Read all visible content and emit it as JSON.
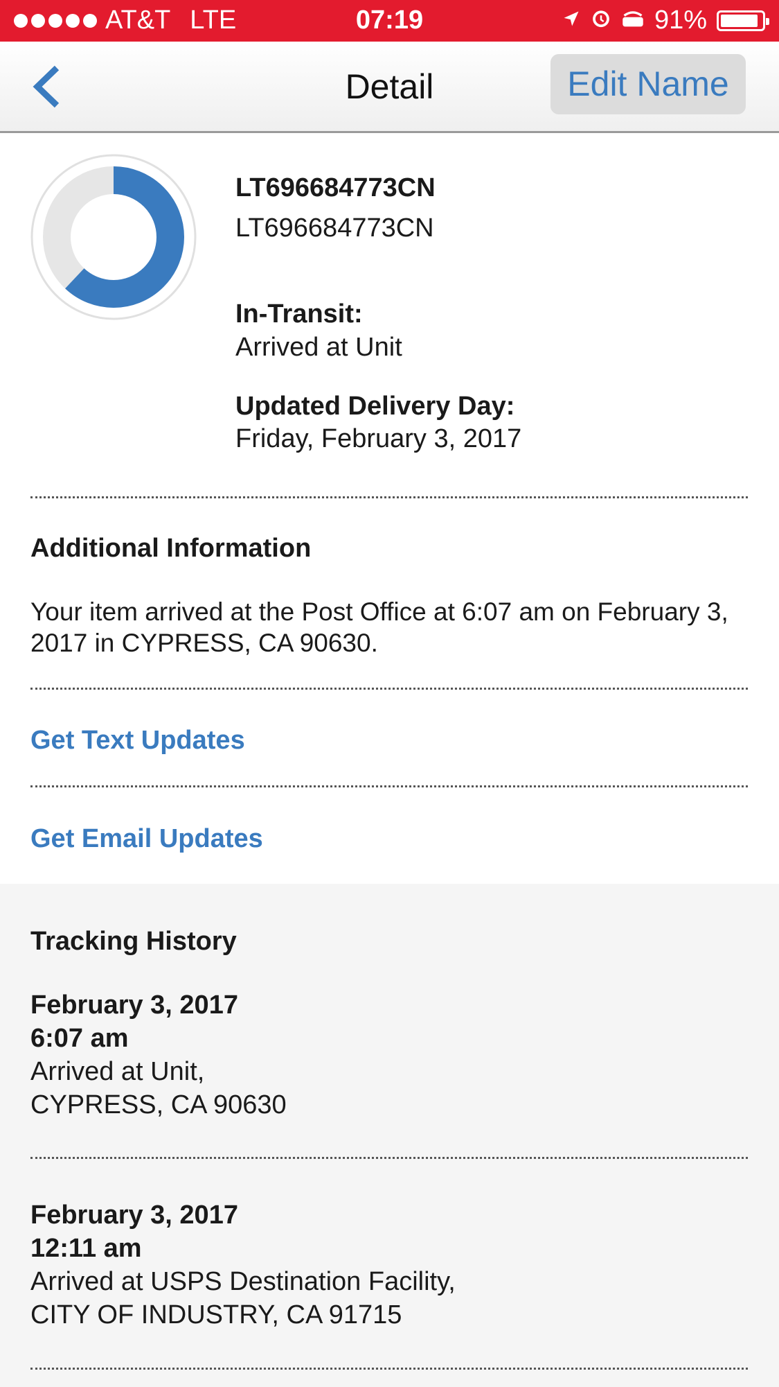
{
  "status_bar": {
    "carrier": "AT&T",
    "network": "LTE",
    "time": "07:19",
    "battery": "91%",
    "battery_level": 0.91
  },
  "nav": {
    "back_icon": "chevron-left-icon",
    "title": "Detail",
    "edit_label": "Edit Name"
  },
  "package": {
    "progress": 0.62,
    "tracking_bold": "LT696684773CN",
    "tracking": "LT696684773CN",
    "status_label": "In-Transit:",
    "status_value": "Arrived at Unit",
    "delivery_label": "Updated Delivery Day:",
    "delivery_value": "Friday, February 3, 2017"
  },
  "additional": {
    "title": "Additional Information",
    "text": "Your item arrived at the Post Office at 6:07 am on February 3, 2017 in CYPRESS, CA 90630."
  },
  "links": {
    "text_updates": "Get Text Updates",
    "email_updates": "Get Email Updates"
  },
  "history": {
    "title": "Tracking History",
    "entries": [
      {
        "date": "February 3, 2017",
        "time": "6:07 am",
        "event": "Arrived at Unit,",
        "location": "CYPRESS, CA 90630"
      },
      {
        "date": "February 3, 2017",
        "time": "12:11 am",
        "event": "Arrived at USPS Destination Facility,",
        "location": "CITY OF INDUSTRY, CA 91715"
      }
    ]
  },
  "colors": {
    "status_bar": "#e31b2e",
    "accent": "#3a7bbf",
    "history_bg": "#f5f5f5"
  }
}
